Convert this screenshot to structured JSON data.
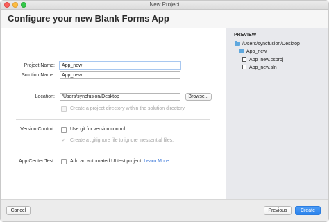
{
  "window": {
    "title": "New Project"
  },
  "header": {
    "title": "Configure your new Blank Forms App"
  },
  "form": {
    "project_name_label": "Project Name:",
    "project_name_value": "App_new",
    "solution_name_label": "Solution Name:",
    "solution_name_value": "App_new",
    "location_label": "Location:",
    "location_value": "/Users/syncfusion/Desktop",
    "browse_label": "Browse...",
    "create_dir_label": "Create a project directory within the solution directory.",
    "version_control_label": "Version Control:",
    "use_git_label": "Use git for version control.",
    "gitignore_label": "Create a .gitignore file to ignore inessential files.",
    "app_center_label": "App Center Test:",
    "ui_test_label": "Add an automated UI test project.",
    "learn_more_label": "Learn More"
  },
  "preview": {
    "heading": "PREVIEW",
    "items": [
      {
        "icon": "folder-icon",
        "label": "/Users/syncfusion/Desktop"
      },
      {
        "icon": "folder-icon",
        "label": "App_new"
      },
      {
        "icon": "file-icon",
        "label": "App_new.csproj"
      },
      {
        "icon": "file-icon",
        "label": "App_new.sln"
      }
    ]
  },
  "footer": {
    "cancel_label": "Cancel",
    "previous_label": "Previous",
    "create_label": "Create"
  },
  "colors": {
    "accent": "#2a82ec",
    "folder": "#5fa8de",
    "link": "#2f6fd6",
    "preview_bg": "#e8e9ed"
  }
}
